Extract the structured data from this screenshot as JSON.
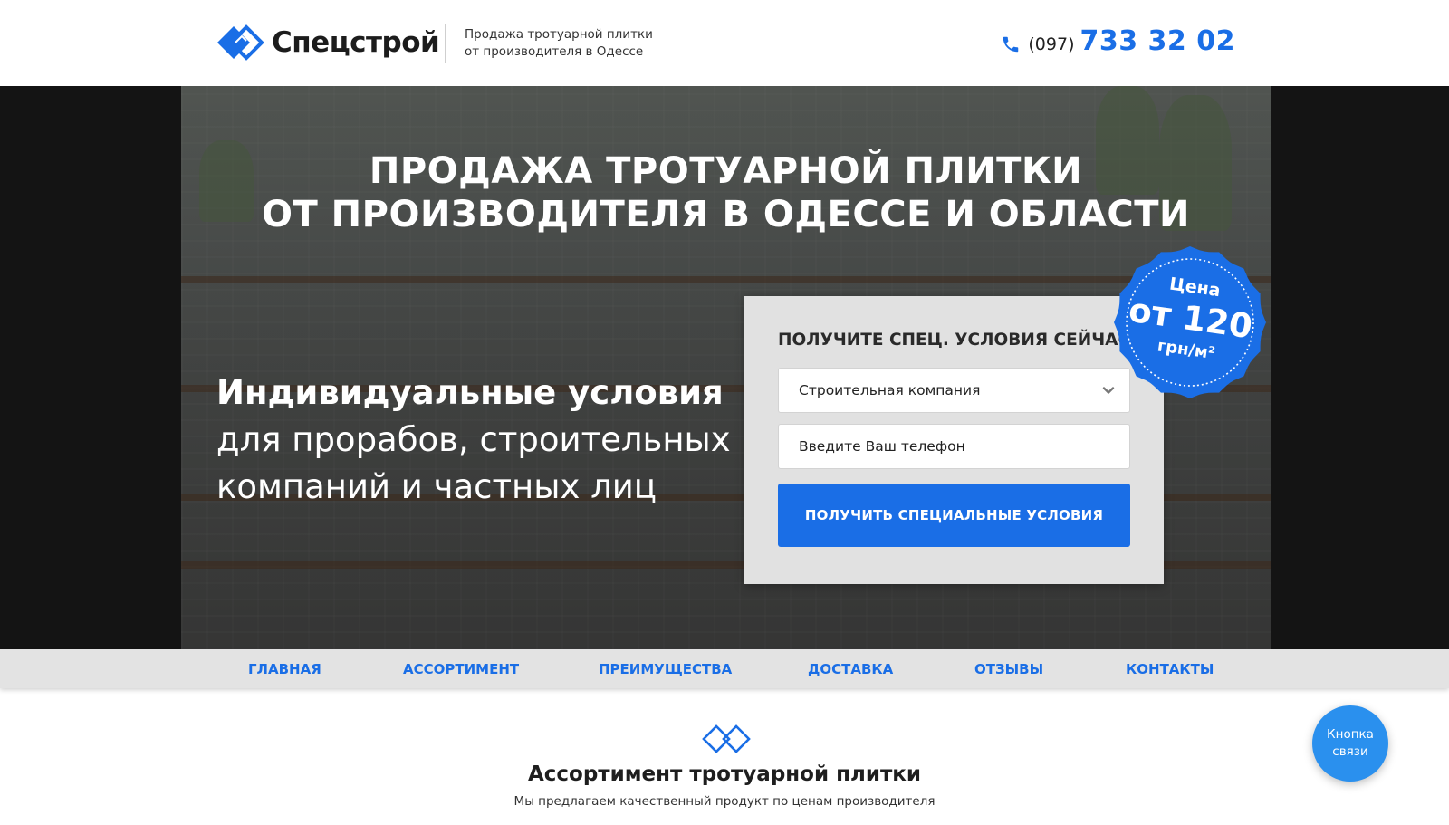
{
  "header": {
    "brand_name": "Спецстрой",
    "tagline_line1": "Продажа тротуарной плитки",
    "tagline_line2": "от производителя в Одессе",
    "phone_code": "(097)",
    "phone_number": "733 32 02",
    "logo_icon": "double-diamond-logo-icon",
    "phone_icon": "phone-icon"
  },
  "hero": {
    "title_line1": "ПРОДАЖА ТРОТУАРНОЙ ПЛИТКИ",
    "title_line2": "ОТ ПРОИЗВОДИТЕЛЯ В ОДЕССЕ И ОБЛАСТИ",
    "sub_strong": "Индивидуальные условия",
    "sub_line2": "для прорабов, строительных",
    "sub_line3": "компаний и частных лиц"
  },
  "form": {
    "title": "ПОЛУЧИТЕ СПЕЦ. УСЛОВИЯ СЕЙЧАС!",
    "select_value": "Строительная компания",
    "phone_placeholder": "Введите Ваш телефон",
    "submit_label": "ПОЛУЧИТЬ СПЕЦИАЛЬНЫЕ УСЛОВИЯ"
  },
  "badge": {
    "label": "Цена",
    "price": "от 120",
    "unit": "грн/м²"
  },
  "nav": {
    "items": [
      {
        "label": "ГЛАВНАЯ"
      },
      {
        "label": "АССОРТИМЕНТ"
      },
      {
        "label": "ПРЕИМУЩЕСТВА"
      },
      {
        "label": "ДОСТАВКА"
      },
      {
        "label": "ОТЗЫВЫ"
      },
      {
        "label": "КОНТАКТЫ"
      }
    ]
  },
  "section": {
    "title": "Ассортимент тротуарной плитки",
    "subtitle": "Мы предлагаем качественный продукт по ценам производителя"
  },
  "contact_fab": {
    "line1": "Кнопка",
    "line2": "связи"
  },
  "colors": {
    "accent": "#1a6ee6",
    "badge": "#1a6ee6",
    "fab": "#2a90ee",
    "nav_bg": "#e3e3e3",
    "form_bg": "#e1e1e1"
  }
}
